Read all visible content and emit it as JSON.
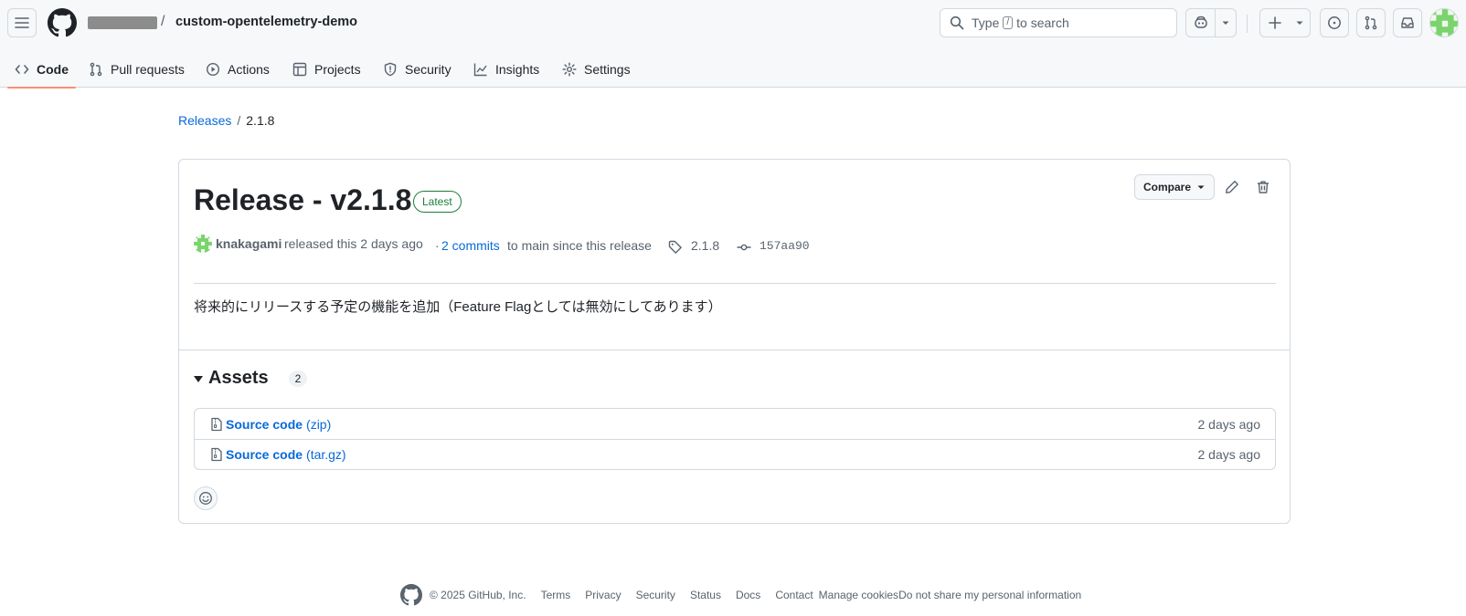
{
  "header": {
    "repo_separator": "/",
    "repo_name": "custom-opentelemetry-demo",
    "search": {
      "pre": "Type",
      "key": "/",
      "post": "to search"
    }
  },
  "nav": {
    "tabs": [
      {
        "label": "Code",
        "icon": "code-icon"
      },
      {
        "label": "Pull requests",
        "icon": "pull-request-icon"
      },
      {
        "label": "Actions",
        "icon": "play-icon"
      },
      {
        "label": "Projects",
        "icon": "table-icon"
      },
      {
        "label": "Security",
        "icon": "shield-icon"
      },
      {
        "label": "Insights",
        "icon": "graph-icon"
      },
      {
        "label": "Settings",
        "icon": "gear-icon"
      }
    ],
    "active_tab": "Code"
  },
  "breadcrumb": {
    "parent": "Releases",
    "separator": "/",
    "current": "2.1.8"
  },
  "release": {
    "title": "Release - v2.1.8",
    "badge": "Latest",
    "compare_label": "Compare",
    "author": "knakagami",
    "released_text": "released this 2 days ago",
    "commits_prefix": "·",
    "commits_link": "2 commits",
    "commits_suffix": "to main since this release",
    "tag": "2.1.8",
    "commit_sha": "157aa90",
    "body": "将来的にリリースする予定の機能を追加（Feature Flagとしては無効にしてあります）"
  },
  "assets": {
    "title": "Assets",
    "count": "2",
    "items": [
      {
        "name": "Source code",
        "ext": "(zip)",
        "date": "2 days ago"
      },
      {
        "name": "Source code",
        "ext": "(tar.gz)",
        "date": "2 days ago"
      }
    ]
  },
  "footer": {
    "copyright": "© 2025 GitHub, Inc.",
    "links": [
      "Terms",
      "Privacy",
      "Security",
      "Status",
      "Docs",
      "Contact",
      "Manage cookies",
      "Do not share my personal information"
    ]
  },
  "colors": {
    "link": "#0969da",
    "latest": "#1a7f37",
    "active_tab": "#fd8c73",
    "avatar": "#7bd36d"
  }
}
